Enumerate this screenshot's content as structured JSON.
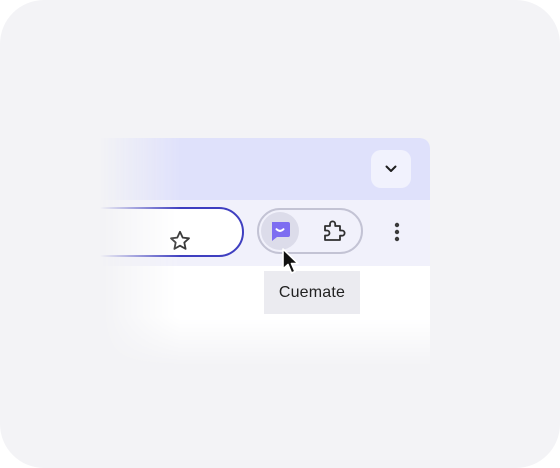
{
  "tooltip": {
    "text": "Cuemate"
  },
  "toolbar": {
    "icons": {
      "tab_dropdown": "chevron-down-icon",
      "bookmark": "star-icon",
      "extension": "cuemate-icon",
      "extensions_menu": "puzzle-icon",
      "more": "more-vert-icon"
    }
  },
  "colors": {
    "tabstrip": "#dfe1fb",
    "toolbar": "#f1f1fb",
    "omnibox_focus_border": "#3f3fc0",
    "cuemate_accent": "#7d6df1",
    "tooltip_bg": "#ebebf0"
  }
}
